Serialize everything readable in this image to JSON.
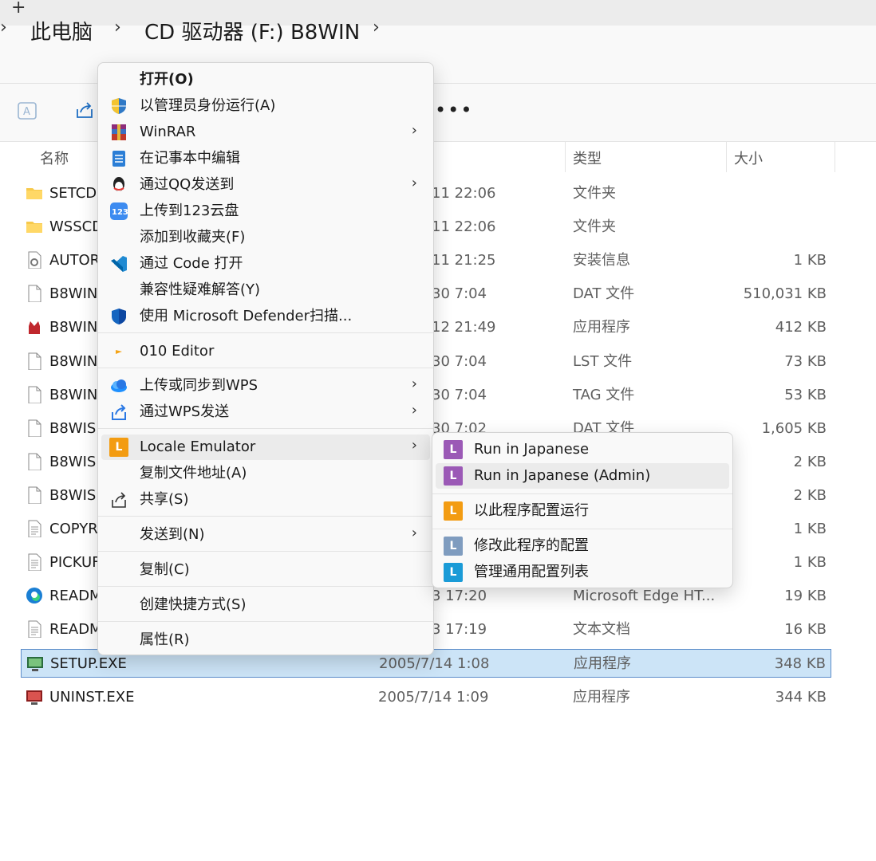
{
  "window": {
    "new_tab_glyph": "+"
  },
  "breadcrumb": {
    "items": [
      "此电脑",
      "CD 驱动器 (F:) B8WIN"
    ],
    "separator": "›"
  },
  "toolbar": {
    "more_label": "•••",
    "icons": [
      "rename-icon",
      "share-icon"
    ]
  },
  "columns": {
    "name": "名称",
    "type": "类型",
    "size": "大小"
  },
  "files": [
    {
      "name": "SETCDI",
      "date": "11 22:06",
      "type": "文件夹",
      "size": "",
      "icon": "folder-icon"
    },
    {
      "name": "WSSCD",
      "date": "11 22:06",
      "type": "文件夹",
      "size": "",
      "icon": "folder-icon"
    },
    {
      "name": "AUTOR",
      "date": "11 21:25",
      "type": "安装信息",
      "size": "1 KB",
      "icon": "setup-info-icon"
    },
    {
      "name": "B8WIN",
      "date": "30 7:04",
      "type": "DAT 文件",
      "size": "510,031 KB",
      "icon": "file-icon"
    },
    {
      "name": "B8WIN",
      "date": "12 21:49",
      "type": "应用程序",
      "size": "412 KB",
      "icon": "app-icon"
    },
    {
      "name": "B8WIN",
      "date": "30 7:04",
      "type": "LST 文件",
      "size": "73 KB",
      "icon": "file-icon"
    },
    {
      "name": "B8WIN",
      "date": "30 7:04",
      "type": "TAG 文件",
      "size": "53 KB",
      "icon": "file-icon"
    },
    {
      "name": "B8WIS.",
      "date": "30 7:02",
      "type": "DAT 文件",
      "size": "1,605 KB",
      "icon": "file-icon"
    },
    {
      "name": "B8WIS.",
      "date": "",
      "type": "",
      "size": "2 KB",
      "icon": "file-icon"
    },
    {
      "name": "B8WIS.",
      "date": "",
      "type": "",
      "size": "2 KB",
      "icon": "file-icon"
    },
    {
      "name": "COPYR",
      "date": "",
      "type": "",
      "size": "1 KB",
      "icon": "text-file-icon"
    },
    {
      "name": "PICKUF",
      "date": "",
      "type": "",
      "size": "1 KB",
      "icon": "text-file-icon"
    },
    {
      "name": "READM",
      "date": "3 17:20",
      "type": "Microsoft Edge HT...",
      "size": "19 KB",
      "icon": "edge-icon"
    },
    {
      "name": "READM",
      "date": "3 17:19",
      "type": "文本文档",
      "size": "16 KB",
      "icon": "text-file-icon"
    },
    {
      "name": "SETUP.EXE",
      "date": "2005/7/14 1:08",
      "type": "应用程序",
      "size": "348 KB",
      "icon": "setup-exe-icon",
      "selected": true
    },
    {
      "name": "UNINST.EXE",
      "date": "2005/7/14 1:09",
      "type": "应用程序",
      "size": "344 KB",
      "icon": "uninst-exe-icon"
    }
  ],
  "context_menu": {
    "items": [
      {
        "label": "打开(O)",
        "bold": true,
        "icon": ""
      },
      {
        "label": "以管理员身份运行(A)",
        "icon": "uac-shield-icon"
      },
      {
        "label": "WinRAR",
        "icon": "winrar-icon",
        "submenu": true
      },
      {
        "label": "在记事本中编辑",
        "icon": "notepad-icon"
      },
      {
        "label": "通过QQ发送到",
        "icon": "qq-icon",
        "submenu": true
      },
      {
        "label": "上传到123云盘",
        "icon": "cloud-123-icon"
      },
      {
        "label": "添加到收藏夹(F)",
        "icon": ""
      },
      {
        "label": "通过 Code 打开",
        "icon": "vscode-icon"
      },
      {
        "label": "兼容性疑难解答(Y)",
        "icon": ""
      },
      {
        "label": "使用 Microsoft Defender扫描...",
        "icon": "defender-icon"
      },
      {
        "label": "010 Editor",
        "icon": "010-editor-icon"
      },
      {
        "label": "上传或同步到WPS",
        "icon": "wps-cloud-icon",
        "submenu": true
      },
      {
        "label": "通过WPS发送",
        "icon": "wps-send-icon",
        "submenu": true
      },
      {
        "label": "Locale Emulator",
        "icon": "locale-emulator-icon",
        "submenu": true,
        "hover": true
      },
      {
        "label": "复制文件地址(A)",
        "icon": ""
      },
      {
        "label": "共享(S)",
        "icon": "share-icon"
      },
      {
        "label": "发送到(N)",
        "icon": "",
        "submenu": true
      },
      {
        "label": "复制(C)",
        "icon": ""
      },
      {
        "label": "创建快捷方式(S)",
        "icon": ""
      },
      {
        "label": "属性(R)",
        "icon": ""
      }
    ],
    "arrow": "›"
  },
  "locale_submenu": {
    "items": [
      {
        "label": "Run in Japanese",
        "icon_letter": "L",
        "color": "#9b59b6"
      },
      {
        "label": "Run in Japanese (Admin)",
        "icon_letter": "L",
        "color": "#9b59b6",
        "hover": true
      },
      {
        "label": "以此程序配置运行",
        "icon_letter": "L",
        "color": "#f39c12"
      },
      {
        "label": "修改此程序的配置",
        "icon_letter": "L",
        "color": "#7f9cbf"
      },
      {
        "label": "管理通用配置列表",
        "icon_letter": "L",
        "color": "#1a9bd7"
      }
    ]
  },
  "colors": {
    "selection": "#cce4f7",
    "selection_border": "#5b8cc9",
    "menu_bg": "#f9f9f9"
  }
}
